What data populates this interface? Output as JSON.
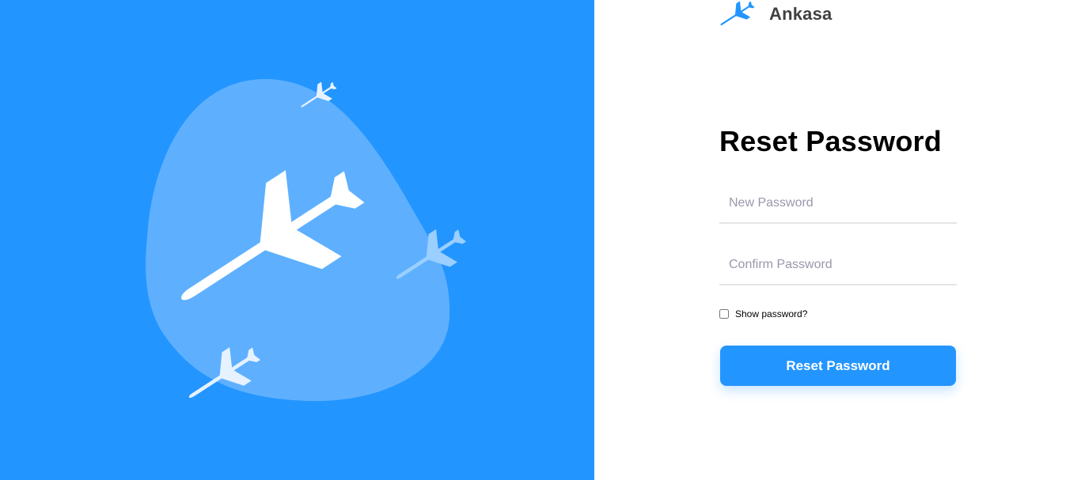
{
  "brand": {
    "name": "Ankasa"
  },
  "form": {
    "title": "Reset Password",
    "new_password": {
      "placeholder": "New Password",
      "value": ""
    },
    "confirm_password": {
      "placeholder": "Confirm Password",
      "value": ""
    },
    "show_password_label": "Show password?",
    "show_password_checked": false,
    "submit_label": "Reset Password"
  },
  "colors": {
    "primary": "#2395ff",
    "blob": "#5eb0ff",
    "text_dark": "#000000",
    "brand_text": "#414141",
    "placeholder": "#9b96ab",
    "underline": "#e5e5e5"
  },
  "icons": {
    "logo": "plane-icon",
    "hero_plane": "plane-icon"
  }
}
